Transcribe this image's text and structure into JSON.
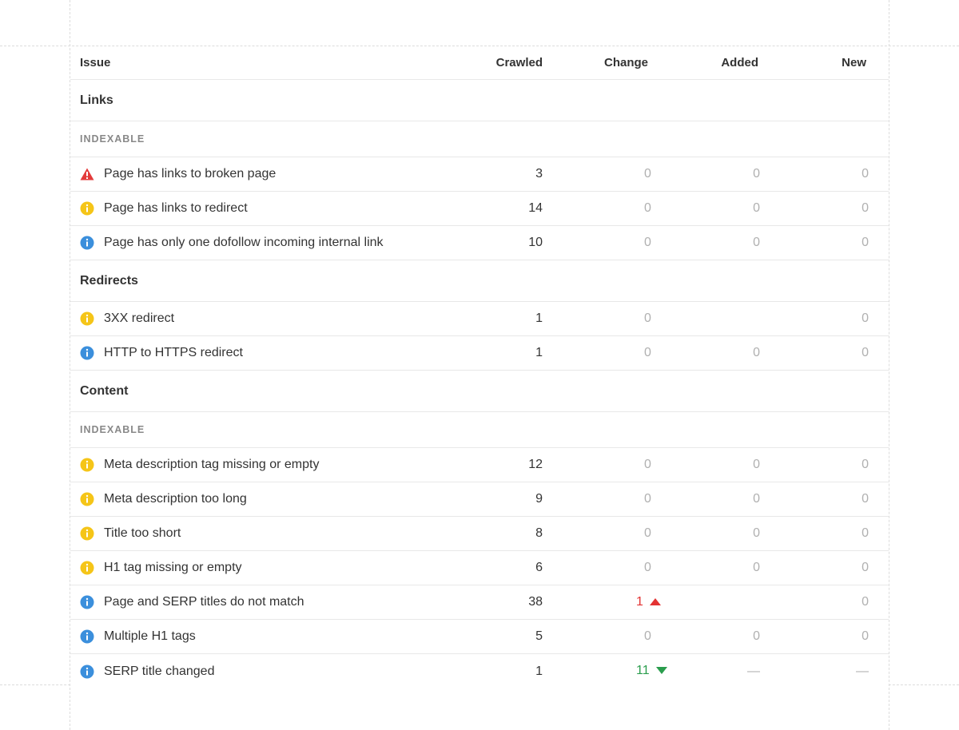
{
  "columns": {
    "issue": "Issue",
    "crawled": "Crawled",
    "change": "Change",
    "added": "Added",
    "new": "New"
  },
  "colors": {
    "error": "#e33b3b",
    "warning": "#f5c518",
    "notice": "#3b8fdc",
    "change_up": "#e33333",
    "change_down": "#2a9d4d"
  },
  "groups": [
    {
      "title": "Links",
      "subgroups": [
        {
          "label": "INDEXABLE",
          "rows": [
            {
              "icon": "error-triangle-icon",
              "issue": "Page has links to broken page",
              "crawled": "3",
              "change": "0",
              "added": "0",
              "new": "0"
            },
            {
              "icon": "warning-info-icon",
              "issue": "Page has links to redirect",
              "crawled": "14",
              "change": "0",
              "added": "0",
              "new": "0"
            },
            {
              "icon": "notice-info-icon",
              "issue": "Page has only one dofollow incoming internal link",
              "crawled": "10",
              "change": "0",
              "added": "0",
              "new": "0"
            }
          ]
        }
      ]
    },
    {
      "title": "Redirects",
      "subgroups": [
        {
          "label": "",
          "rows": [
            {
              "icon": "warning-info-icon",
              "issue": "3XX redirect",
              "crawled": "1",
              "change": "0",
              "added": "",
              "new": "0"
            },
            {
              "icon": "notice-info-icon",
              "issue": "HTTP to HTTPS redirect",
              "crawled": "1",
              "change": "0",
              "added": "0",
              "new": "0"
            }
          ]
        }
      ]
    },
    {
      "title": "Content",
      "subgroups": [
        {
          "label": "INDEXABLE",
          "rows": [
            {
              "icon": "warning-info-icon",
              "issue": "Meta description tag missing or empty",
              "crawled": "12",
              "change": "0",
              "added": "0",
              "new": "0"
            },
            {
              "icon": "warning-info-icon",
              "issue": "Meta description too long",
              "crawled": "9",
              "change": "0",
              "added": "0",
              "new": "0"
            },
            {
              "icon": "warning-info-icon",
              "issue": "Title too short",
              "crawled": "8",
              "change": "0",
              "added": "0",
              "new": "0"
            },
            {
              "icon": "warning-info-icon",
              "issue": "H1 tag missing or empty",
              "crawled": "6",
              "change": "0",
              "added": "0",
              "new": "0"
            },
            {
              "icon": "notice-info-icon",
              "issue": "Page and SERP titles do not match",
              "crawled": "38",
              "change": "1",
              "change_dir": "up",
              "added": "",
              "new": "0"
            },
            {
              "icon": "notice-info-icon",
              "issue": "Multiple H1 tags",
              "crawled": "5",
              "change": "0",
              "added": "0",
              "new": "0"
            },
            {
              "icon": "notice-info-icon",
              "issue": "SERP title changed",
              "crawled": "1",
              "change": "11",
              "change_dir": "down",
              "added": "—",
              "new": "—"
            }
          ]
        }
      ]
    }
  ]
}
